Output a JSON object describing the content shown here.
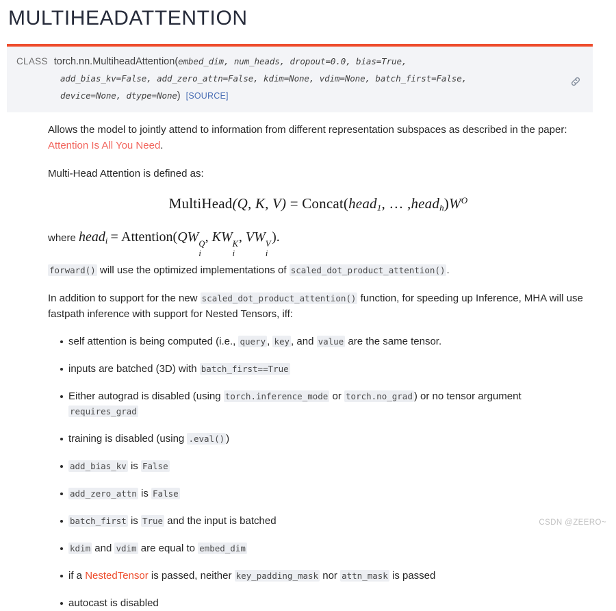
{
  "page_title": "MULTIHEADATTENTION",
  "signature": {
    "kind_label": "CLASS",
    "qualified_name": "torch.nn.MultiheadAttention",
    "open_paren": "(",
    "params_line1": "embed_dim, num_heads, dropout=0.0, bias=True,",
    "params_line2": "add_bias_kv=False, add_zero_attn=False, kdim=None, vdim=None, batch_first=False,",
    "params_line3": "device=None, dtype=None",
    "close_paren": ")",
    "source_link": "[SOURCE]",
    "anchor_icon": "link-icon",
    "accent_color": "#ee4c2c",
    "background_color": "#f3f4f7"
  },
  "body": {
    "intro_text": "Allows the model to jointly attend to information from different representation subspaces as described in the paper:",
    "paper_link": "Attention Is All You Need",
    "intro_period": ".",
    "defined_as": "Multi-Head Attention is defined as:",
    "formula_main": {
      "lhs_name": "MultiHead",
      "lhs_args": "(Q, K, V)",
      "equals": "=",
      "rhs_name": "Concat",
      "rhs_open": "(",
      "head_1": "head",
      "head_1_sub": "1",
      "ellipsis": ", … ,",
      "head_h": "head",
      "head_h_sub": "h",
      "rhs_close": ")",
      "w_symbol": "W",
      "w_sup": "O"
    },
    "formula_where": {
      "where_word": "where",
      "head_i": "head",
      "head_i_sub": "i",
      "equals": "=",
      "attention": "Attention",
      "open": "(",
      "term1_pre": "QW",
      "term1_sup": "Q",
      "term1_sub": "i",
      "term2_pre": "KW",
      "term2_sup": "K",
      "term2_sub": "i",
      "term3_pre": "VW",
      "term3_sup": "V",
      "term3_sub": "i",
      "close": ")",
      "period": "."
    },
    "forward_para": {
      "code_forward": "forward()",
      "mid_text": " will use the optimized implementations of ",
      "code_sdpa": "scaled_dot_product_attention()",
      "end_text": "."
    },
    "fastpath_para": {
      "pre_text": "In addition to support for the new ",
      "code_sdpa": "scaled_dot_product_attention()",
      "post_text": " function, for speeding up Inference, MHA will use fastpath inference with support for Nested Tensors, iff:"
    },
    "bullets": [
      {
        "parts": [
          {
            "t": "text",
            "v": "self attention is being computed (i.e., "
          },
          {
            "t": "code",
            "v": "query"
          },
          {
            "t": "text",
            "v": ", "
          },
          {
            "t": "code",
            "v": "key"
          },
          {
            "t": "text",
            "v": ", and "
          },
          {
            "t": "code",
            "v": "value"
          },
          {
            "t": "text",
            "v": " are the same tensor."
          }
        ]
      },
      {
        "parts": [
          {
            "t": "text",
            "v": "inputs are batched (3D) with "
          },
          {
            "t": "code",
            "v": "batch_first==True"
          }
        ]
      },
      {
        "parts": [
          {
            "t": "text",
            "v": "Either autograd is disabled (using "
          },
          {
            "t": "code",
            "v": "torch.inference_mode"
          },
          {
            "t": "text",
            "v": " or "
          },
          {
            "t": "code",
            "v": "torch.no_grad"
          },
          {
            "t": "text",
            "v": ") or no tensor argument "
          },
          {
            "t": "code",
            "v": "requires_grad"
          }
        ]
      },
      {
        "parts": [
          {
            "t": "text",
            "v": "training is disabled (using "
          },
          {
            "t": "code",
            "v": ".eval()"
          },
          {
            "t": "text",
            "v": ")"
          }
        ]
      },
      {
        "parts": [
          {
            "t": "code",
            "v": "add_bias_kv"
          },
          {
            "t": "text",
            "v": " is "
          },
          {
            "t": "code",
            "v": "False"
          }
        ]
      },
      {
        "parts": [
          {
            "t": "code",
            "v": "add_zero_attn"
          },
          {
            "t": "text",
            "v": " is "
          },
          {
            "t": "code",
            "v": "False"
          }
        ]
      },
      {
        "parts": [
          {
            "t": "code",
            "v": "batch_first"
          },
          {
            "t": "text",
            "v": " is "
          },
          {
            "t": "code",
            "v": "True"
          },
          {
            "t": "text",
            "v": " and the input is batched"
          }
        ]
      },
      {
        "parts": [
          {
            "t": "code",
            "v": "kdim"
          },
          {
            "t": "text",
            "v": " and "
          },
          {
            "t": "code",
            "v": "vdim"
          },
          {
            "t": "text",
            "v": " are equal to "
          },
          {
            "t": "code",
            "v": "embed_dim"
          }
        ]
      },
      {
        "parts": [
          {
            "t": "text",
            "v": "if a "
          },
          {
            "t": "link",
            "v": "NestedTensor"
          },
          {
            "t": "text",
            "v": " is passed, neither "
          },
          {
            "t": "code",
            "v": "key_padding_mask"
          },
          {
            "t": "text",
            "v": " nor "
          },
          {
            "t": "code",
            "v": "attn_mask"
          },
          {
            "t": "text",
            "v": " is passed"
          }
        ]
      },
      {
        "parts": [
          {
            "t": "text",
            "v": "autocast is disabled"
          }
        ]
      }
    ]
  },
  "watermark": "CSDN @ZEERO~"
}
